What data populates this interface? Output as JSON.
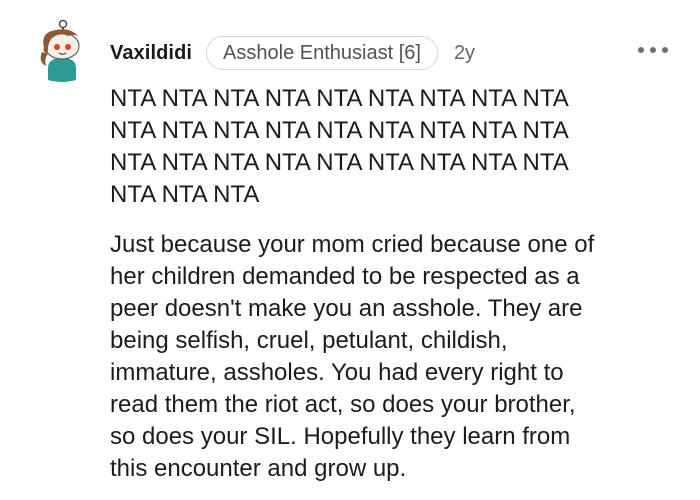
{
  "comment": {
    "author": "Vaxildidi",
    "flair": "Asshole Enthusiast [6]",
    "age": "2y",
    "more_options_icon": "horizontal-ellipsis-icon",
    "avatar_icon": "snoo-avatar-icon",
    "paragraphs": [
      "NTA NTA NTA NTA NTA NTA NTA NTA NTA\nNTA NTA NTA NTA NTA NTA NTA NTA NTA\nNTA NTA NTA NTA NTA NTA NTA NTA NTA\nNTA NTA NTA",
      "Just because your mom cried because one of\nher children demanded to be respected as a\npeer doesn't make you an asshole. They are\nbeing selfish, cruel, petulant, childish,\nimmature, assholes. You had every right to\nread them the riot act, so does your brother,\nso does your SIL. Hopefully they learn from\nthis encounter and grow up."
    ]
  },
  "colors": {
    "text": "#1c1c1c",
    "meta": "#63676b",
    "flair_border": "#d4d7d9",
    "avatar_teal": "#2d9b96",
    "avatar_hair": "#8a5a35"
  }
}
